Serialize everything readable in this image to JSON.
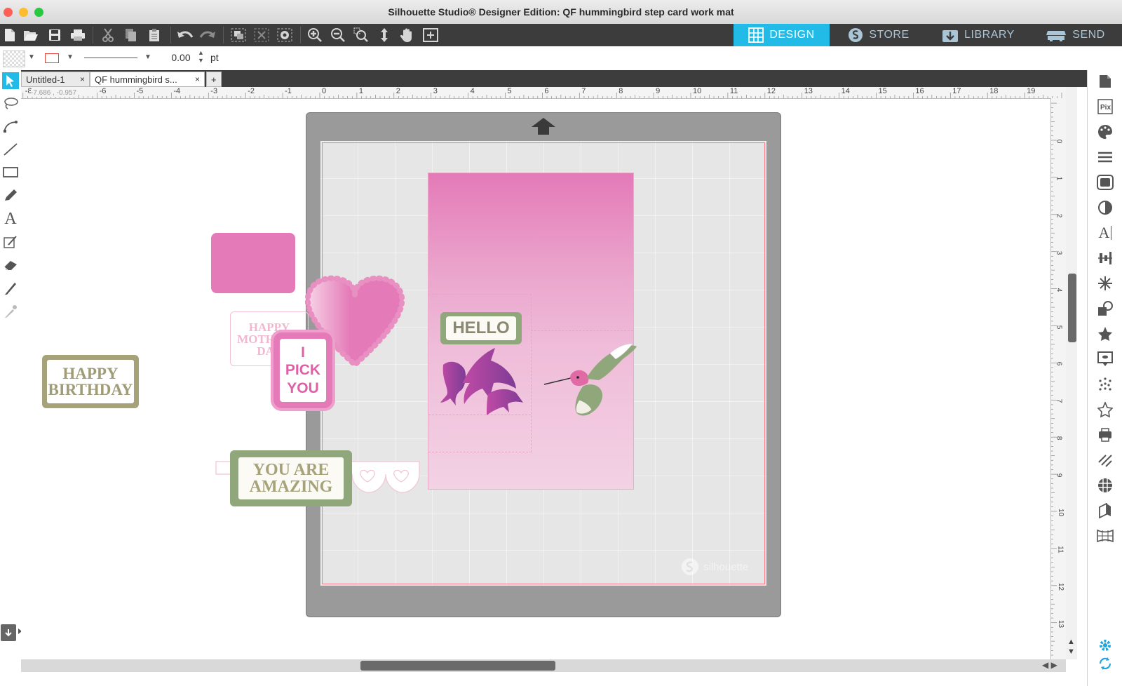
{
  "window": {
    "title": "Silhouette Studio® Designer Edition: QF  hummingbird step card work mat"
  },
  "nav_tabs": [
    {
      "label": "DESIGN",
      "active": true
    },
    {
      "label": "STORE",
      "active": false
    },
    {
      "label": "LIBRARY",
      "active": false
    },
    {
      "label": "SEND",
      "active": false
    }
  ],
  "properties": {
    "line_width": "0.00",
    "unit": "pt"
  },
  "doc_tabs": [
    {
      "label": "Untitled-1",
      "close": "×"
    },
    {
      "label": "QF  hummingbird s...",
      "close": "×"
    }
  ],
  "add_tab": "+",
  "ruler": {
    "coord_x": "-7.686",
    "coord_y": "-0.957",
    "top_labels": [
      "-8",
      "-6",
      "-5",
      "-4",
      "-3",
      "-2",
      "-1",
      "0",
      "1",
      "2",
      "3",
      "4",
      "5",
      "6",
      "7",
      "8",
      "9",
      "10",
      "11",
      "12",
      "13",
      "14",
      "15",
      "16",
      "17",
      "18",
      "19"
    ],
    "side_labels": [
      "0",
      "1",
      "2",
      "3",
      "4",
      "5",
      "6",
      "7",
      "8",
      "9",
      "10",
      "11",
      "12",
      "13"
    ]
  },
  "designs": {
    "happy_birthday": "HAPPY\nBIRTHDAY",
    "happy_mothers_day": "HAPPY\nMOTHER'S\nDAY",
    "i_pick_you": "I\nPICK\nYOU",
    "you_are_amazing": "YOU ARE\nAMAZING",
    "hello": "HELLO",
    "watermark": "silhouette"
  },
  "colors": {
    "accent_tab": "#22bbe8",
    "pink": "#e47ab8",
    "olive": "#a6a27a",
    "sage": "#8fa77a"
  }
}
